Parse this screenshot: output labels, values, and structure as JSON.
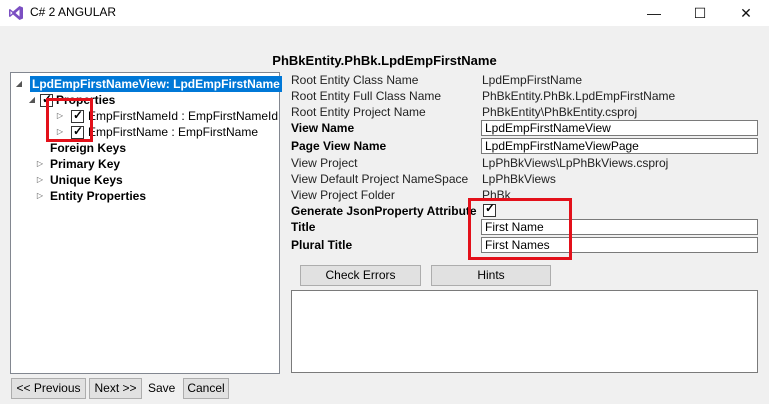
{
  "window": {
    "title": "C# 2 ANGULAR",
    "minimize": "—",
    "maximize": "☐",
    "close": "✕"
  },
  "heading": "PhBkEntity.PhBk.LpdEmpFirstName",
  "tree": {
    "root": "LpdEmpFirstNameView: LpdEmpFirstName",
    "properties": "Properties",
    "prop1": "EmpFirstNameId : EmpFirstNameId",
    "prop2": "EmpFirstName : EmpFirstName",
    "foreign_keys": "Foreign Keys",
    "primary_key": "Primary Key",
    "unique_keys": "Unique Keys",
    "entity_properties": "Entity Properties"
  },
  "details": {
    "root_entity_class_name_label": "Root Entity Class Name",
    "root_entity_class_name": "LpdEmpFirstName",
    "root_entity_full_class_name_label": "Root Entity Full Class Name",
    "root_entity_full_class_name": "PhBkEntity.PhBk.LpdEmpFirstName",
    "root_entity_project_name_label": "Root Entity Project Name",
    "root_entity_project_name": "PhBkEntity\\PhBkEntity.csproj",
    "view_name_label": "View Name",
    "view_name": "LpdEmpFirstNameView",
    "page_view_name_label": "Page View Name",
    "page_view_name": "LpdEmpFirstNameViewPage",
    "view_project_label": "View Project",
    "view_project": "LpPhBkViews\\LpPhBkViews.csproj",
    "view_default_namespace_label": "View Default Project NameSpace",
    "view_default_namespace": "LpPhBkViews",
    "view_project_folder_label": "View Project Folder",
    "view_project_folder": "PhBk",
    "generate_json_label": "Generate JsonProperty Attribute",
    "title_label": "Title",
    "title": "First Name",
    "plural_title_label": "Plural Title",
    "plural_title": "First Names"
  },
  "buttons": {
    "check_errors": "Check Errors",
    "hints": "Hints",
    "previous": "<< Previous",
    "next": "Next >>",
    "save": "Save",
    "cancel": "Cancel"
  },
  "colors": {
    "highlight_box": "#e3101a",
    "selection": "#0078d7"
  }
}
